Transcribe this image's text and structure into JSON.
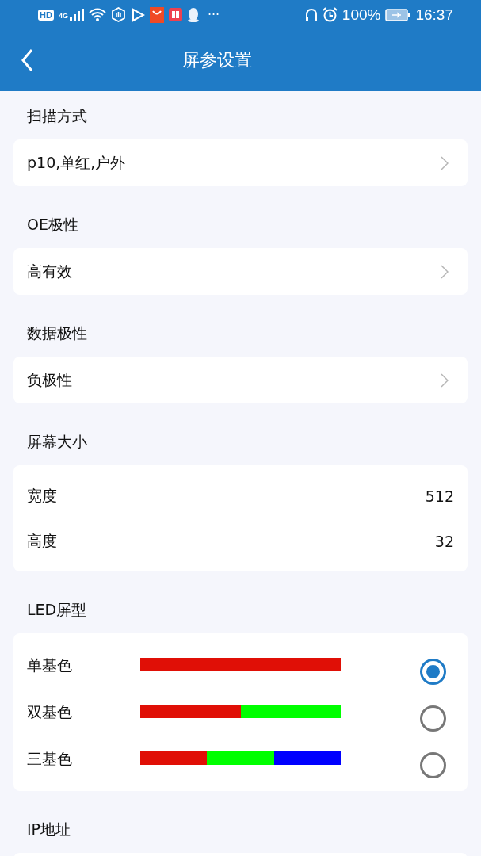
{
  "status_bar": {
    "hd": "HD",
    "network": "4G",
    "more": "···",
    "battery": "100%",
    "time": "16:37"
  },
  "header": {
    "title": "屏参设置"
  },
  "sections": [
    {
      "title": "扫描方式",
      "kind": "select",
      "value": "p10,单红,户外"
    },
    {
      "title": "OE极性",
      "kind": "select",
      "value": "高有效"
    },
    {
      "title": "数据极性",
      "kind": "select",
      "value": "负极性"
    },
    {
      "title": "屏幕大小",
      "kind": "fields",
      "rows": [
        {
          "label": "宽度",
          "value": "512"
        },
        {
          "label": "高度",
          "value": "32"
        }
      ]
    },
    {
      "title": "LED屏型",
      "kind": "radio",
      "options": [
        {
          "label": "单基色",
          "selected": true,
          "segments": [
            {
              "color": "#e00f06"
            }
          ]
        },
        {
          "label": "双基色",
          "selected": false,
          "segments": [
            {
              "color": "#e00f06"
            },
            {
              "color": "#00ff00"
            }
          ]
        },
        {
          "label": "三基色",
          "selected": false,
          "segments": [
            {
              "color": "#e00f06"
            },
            {
              "color": "#00ff00"
            },
            {
              "color": "#0000ff"
            }
          ]
        }
      ]
    },
    {
      "title": "IP地址",
      "kind": "empty"
    }
  ]
}
